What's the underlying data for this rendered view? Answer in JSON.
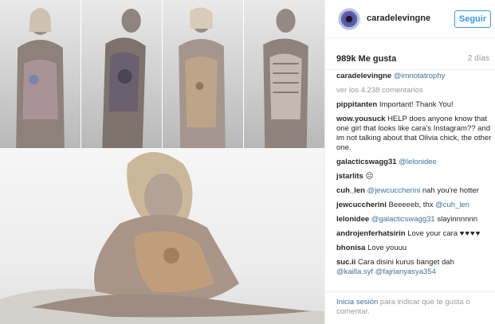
{
  "post": {
    "username": "caradelevingne",
    "follow_label": "Seguir",
    "likes": "989k Me gusta",
    "time": "2 días"
  },
  "caption": {
    "user": "caradelevingne",
    "text": "@imnotatrophy"
  },
  "view_all": "ver los 4.238 comentarios",
  "comments": [
    {
      "user": "pippitanten",
      "text": "Important! Thank You!"
    },
    {
      "user": "wow.yousuck",
      "text": "HELP does anyone know that one girl that looks like cara's Instagram?? and im not talking about that Olivia chick, the other one."
    },
    {
      "user": "galacticswagg31",
      "mention": "@lelonidee",
      "text": ""
    },
    {
      "user": "jstarlits",
      "text": "☹"
    },
    {
      "user": "cuh_len",
      "mention": "@jewcuccherini",
      "text": "nah you're hotter"
    },
    {
      "user": "jewcuccherini",
      "text": "Beeeeeb, thx",
      "mention": "@cuh_len"
    },
    {
      "user": "lelonidee",
      "mention": "@galacticswagg31",
      "text": "slayinnnnnn"
    },
    {
      "user": "androjenferhatsirin",
      "text": "Love your cara",
      "extra": "♥♥♥♥"
    },
    {
      "user": "bhonisa",
      "text": "Love youuu"
    },
    {
      "user": "suc.ii",
      "text": "Cara disini kurus banget dah",
      "mention": "@kailla.syf @fajrianyasya354"
    }
  ],
  "footer": {
    "login_link": "Inicia sesión",
    "rest": "para indicar que te gusta o comentar."
  },
  "colors": {
    "accent": "#3897f0",
    "mention": "#3f729b",
    "muted": "#999999"
  }
}
